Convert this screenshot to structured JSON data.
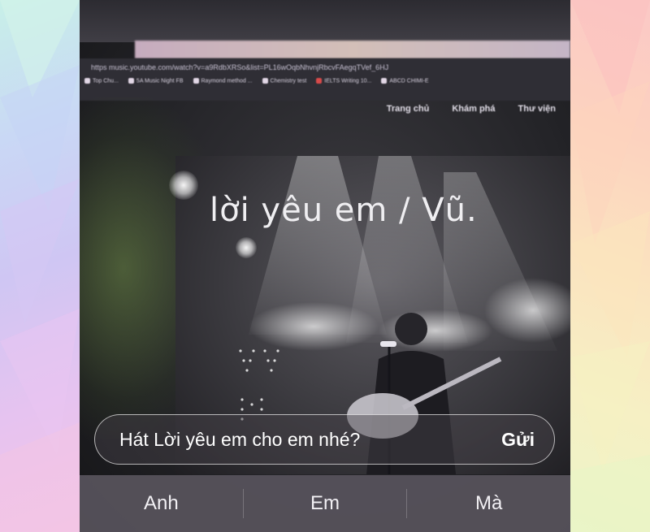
{
  "browser": {
    "url": "https  music.youtube.com/watch?v=a9RdbXRSo&list=PL16wOqbNhvnjRbcvFAegqTVef_6HJ",
    "bookmarks": [
      "Top Chu...",
      "5A Music Night FB",
      "Raymond method ...",
      "Chemistry test",
      "IELTS Writing 10...",
      "ABCD CHIMI-E"
    ],
    "nav": [
      "Trang chủ",
      "Khám phá",
      "Thư viện"
    ]
  },
  "video": {
    "title": "lời yêu em / Vũ."
  },
  "message": {
    "text": "Hát Lời yêu em cho em nhé?",
    "send_label": "Gửi"
  },
  "suggestions": [
    "Anh",
    "Em",
    "Mà"
  ]
}
